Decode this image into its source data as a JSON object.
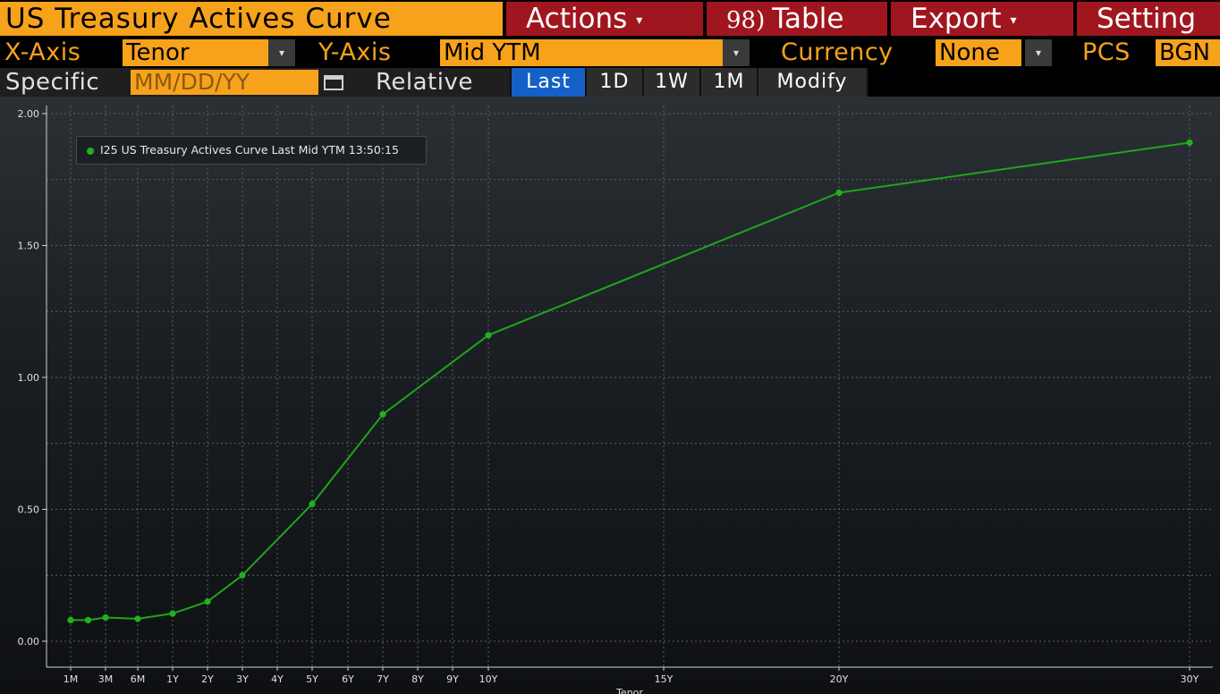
{
  "header": {
    "title": "US Treasury Actives Curve",
    "actions_label": "Actions",
    "table_num": "98)",
    "table_label": "Table",
    "export_label": "Export",
    "settings_label": "Setting",
    "caret": "▾"
  },
  "controls": {
    "x_axis_label": "X-Axis",
    "x_axis_value": "Tenor",
    "y_axis_label": "Y-Axis",
    "y_axis_value": "Mid YTM",
    "currency_label": "Currency",
    "currency_value": "None",
    "pcs_label": "PCS",
    "pcs_value": "BGN",
    "dropdown_arrow": "▾"
  },
  "dates": {
    "specific_label": "Specific",
    "date_placeholder": "MM/DD/YY",
    "relative_label": "Relative",
    "buttons": [
      "Last",
      "1D",
      "1W",
      "1M",
      "Modify"
    ],
    "active": "Last"
  },
  "chart_data": {
    "type": "line",
    "xlabel": "Tenor",
    "ylim": [
      0,
      2.0
    ],
    "y_ticks": [
      "0.00",
      "0.50",
      "1.00",
      "1.50",
      "2.00"
    ],
    "x_tick_labels": [
      "1M",
      "3M",
      "6M",
      "1Y",
      "2Y",
      "3Y",
      "4Y",
      "5Y",
      "6Y",
      "7Y",
      "8Y",
      "9Y",
      "10Y",
      "15Y",
      "20Y",
      "30Y"
    ],
    "grid": true,
    "legend_position": "top-left",
    "series": [
      {
        "name": "I25 US Treasury Actives Curve Last Mid YTM 13:50:15",
        "color": "#1fa51a",
        "points": [
          {
            "x": "1M",
            "y": 0.08
          },
          {
            "x": "2M",
            "y": 0.08
          },
          {
            "x": "3M",
            "y": 0.09
          },
          {
            "x": "6M",
            "y": 0.085
          },
          {
            "x": "1Y",
            "y": 0.105
          },
          {
            "x": "2Y",
            "y": 0.15
          },
          {
            "x": "3Y",
            "y": 0.25
          },
          {
            "x": "5Y",
            "y": 0.52
          },
          {
            "x": "7Y",
            "y": 0.86
          },
          {
            "x": "10Y",
            "y": 1.16
          },
          {
            "x": "20Y",
            "y": 1.7
          },
          {
            "x": "30Y",
            "y": 1.89
          }
        ]
      }
    ]
  }
}
